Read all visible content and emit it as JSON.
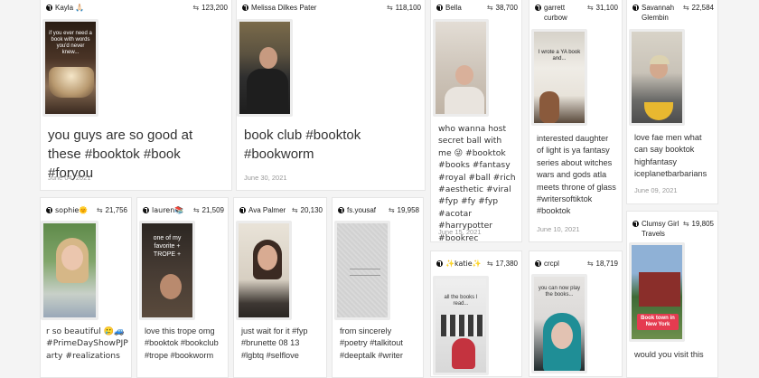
{
  "cards": [
    {
      "id": "kayla",
      "user": "Kayla 🙏🏻",
      "count": "123,200",
      "caption": "you guys are so good at these #booktok #book #foryou",
      "date": "June 04, 2021",
      "thumb_text": "if you ever need a book with words you'd never knew..."
    },
    {
      "id": "melissa",
      "user": "Melissa Dilkes Pater",
      "count": "118,100",
      "caption": "book club #booktok #bookworm",
      "date": "June 30, 2021"
    },
    {
      "id": "bella",
      "user": "Bella",
      "count": "38,700",
      "caption": "who wanna host secret ball with me 😜 #booktok #books #fantasy #royal #ball #rich #aesthetic #viral #fyp #fy #fyp #acotar #harrypotter #bookrec",
      "date": "June 15, 2021"
    },
    {
      "id": "garrett",
      "user": "garrett curbow",
      "count": "31,100",
      "caption": "interested daughter of light is ya fantasy series about witches wars and gods atla meets throne of glass #writersoftiktok #booktok",
      "date": "June 10, 2021",
      "thumb_text": "I wrote a YA book and..."
    },
    {
      "id": "savannah",
      "user": "Savannah Glembin",
      "count": "22,584",
      "caption": "love fae men what can say booktok highfantasy iceplanetbarbarians",
      "date": "June 09, 2021"
    },
    {
      "id": "sophie",
      "user": "sophie🌞",
      "count": "21,756",
      "caption": "r so beautiful 🥲🚙 #PrimeDayShowPJP arty #realizations"
    },
    {
      "id": "lauren",
      "user": "lauren📚",
      "count": "21,509",
      "caption": "love this trope omg #booktok #bookclub #trope #bookworm",
      "thumb_text": "one of my favorite + TROPE +"
    },
    {
      "id": "ava",
      "user": "Ava Palmer",
      "count": "20,130",
      "caption": "just wait for it #fyp #brunette 08 13 #lgbtq #selflove"
    },
    {
      "id": "fsyousaf",
      "user": "fs.yousaf",
      "count": "19,958",
      "caption": "from sincerely #poetry #talkitout #deeptalk #writer"
    },
    {
      "id": "katie",
      "user": "✨katie✨",
      "count": "17,380",
      "caption": "",
      "thumb_text": "all the books I read..."
    },
    {
      "id": "crcpl",
      "user": "crcpl",
      "count": "18,719",
      "caption": "",
      "thumb_text": "you can now play the books..."
    },
    {
      "id": "clumsy",
      "user": "Clumsy Girl Travels",
      "count": "19,805",
      "caption": "would you visit this",
      "thumb_text": "Book town in New York"
    }
  ],
  "colors": {
    "card_bg": "#ffffff",
    "page_bg": "#f4f4f4",
    "text": "#333333",
    "meta": "#999999"
  }
}
